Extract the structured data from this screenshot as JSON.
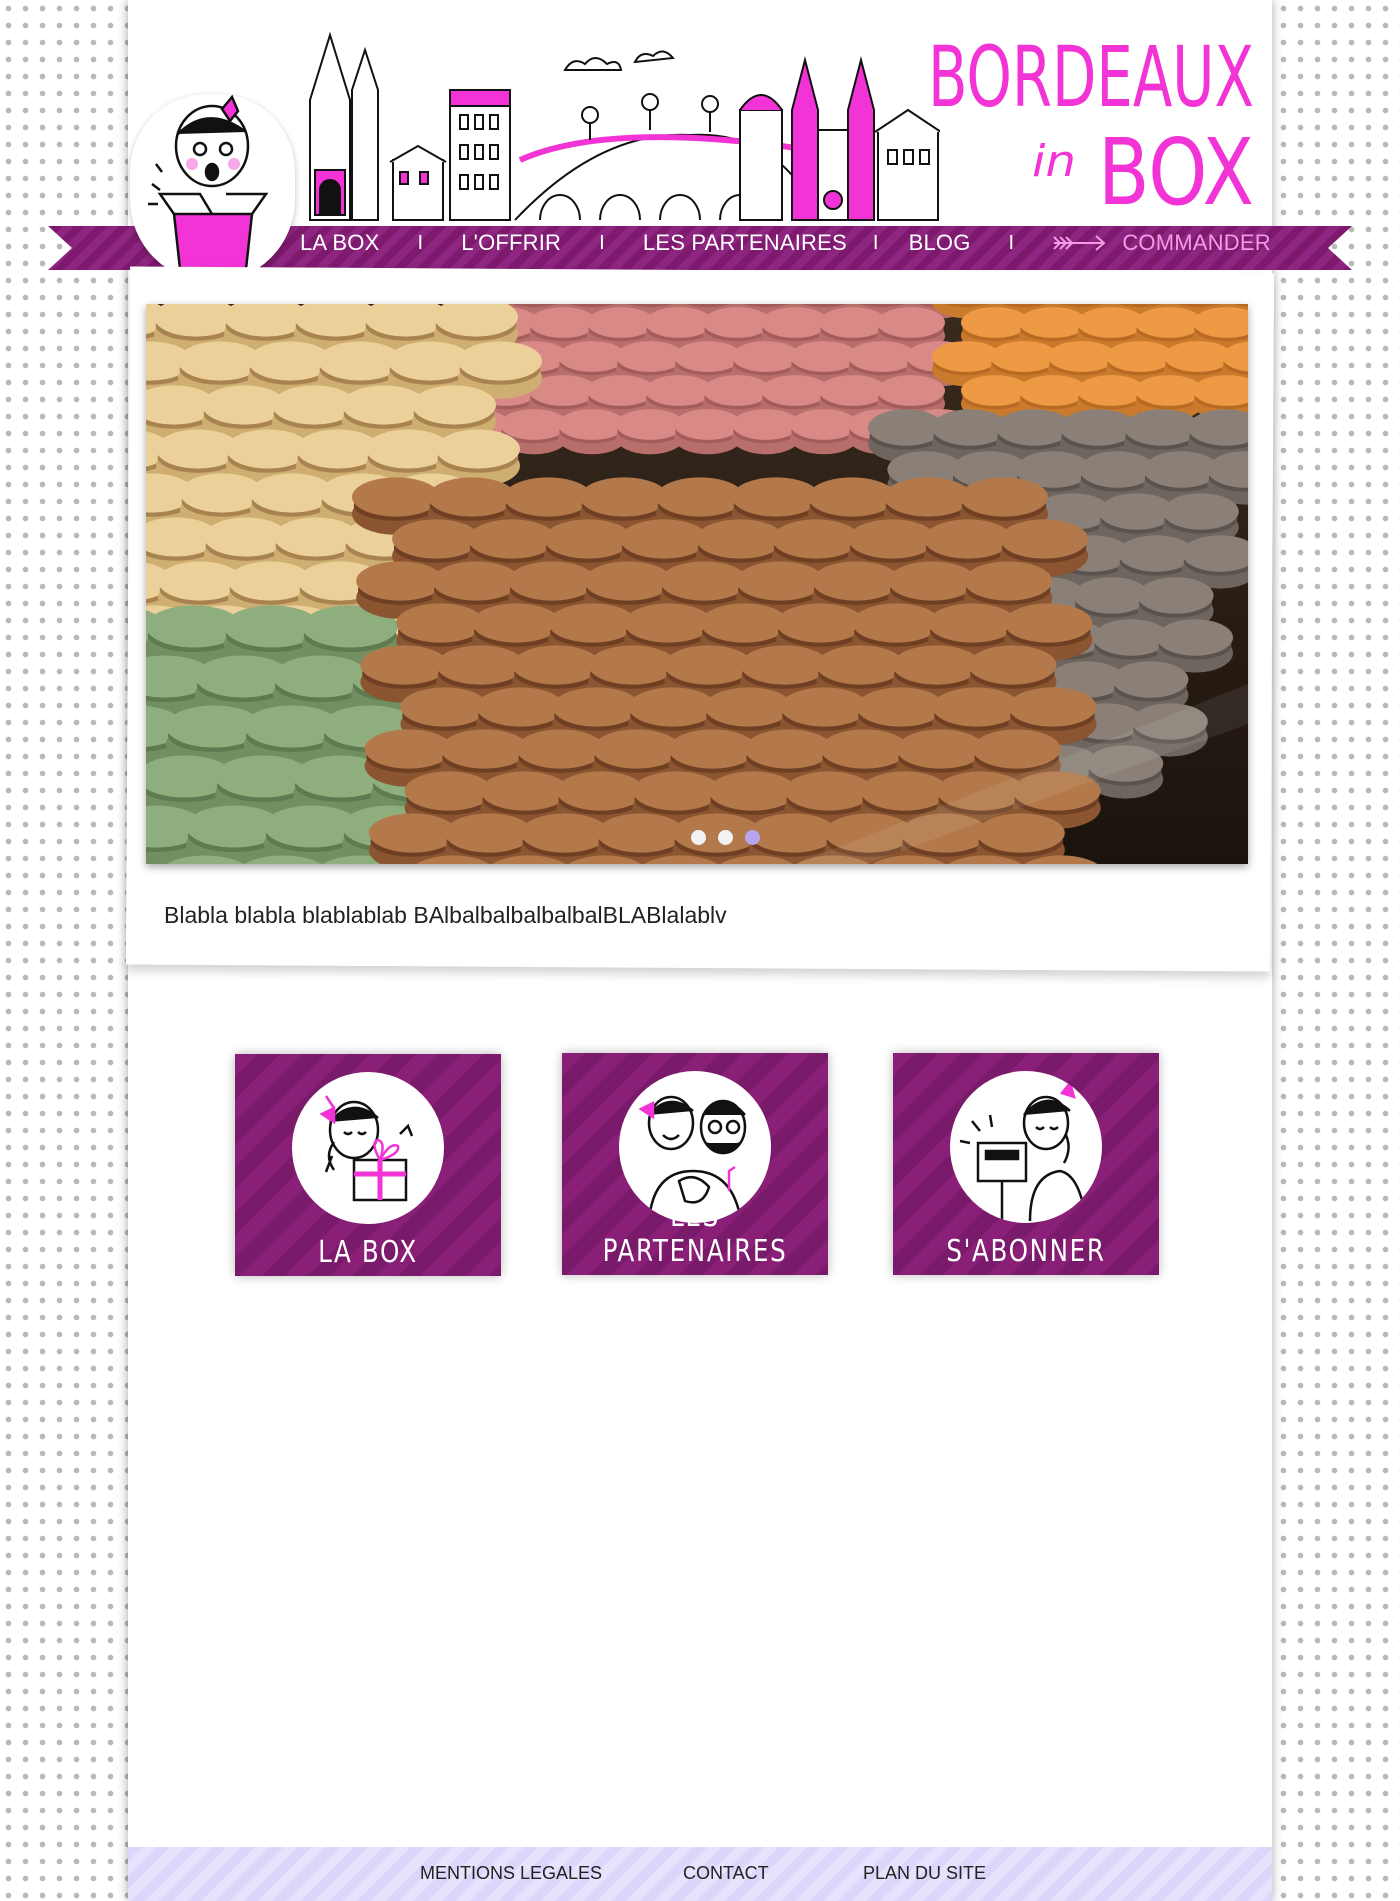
{
  "brand": {
    "logo_line1": "BORDEAUX",
    "logo_in": "in",
    "logo_line2": "BOX",
    "accent": "#f233d6",
    "ribbon_color": "#7d1a6e"
  },
  "nav": {
    "items": [
      {
        "label": "LA BOX"
      },
      {
        "label": "L'OFFRIR"
      },
      {
        "label": "LES PARTENAIRES"
      },
      {
        "label": "BLOG"
      }
    ],
    "separator": "I",
    "cta_label": "COMMANDER",
    "cta_icon": "arrow-right-icon"
  },
  "slider": {
    "image": "macarons-photo",
    "slide_count": 3,
    "active_slide": 3
  },
  "caption": "Blabla blabla blablablab BAlbalbalbalbalbalBLABlalablv",
  "tiles": [
    {
      "label": "LA BOX",
      "icon": "girl-with-gift-icon"
    },
    {
      "label": "LES PARTENAIRES",
      "icon": "partners-icon"
    },
    {
      "label": "S'ABONNER",
      "icon": "girl-with-mailbox-icon"
    }
  ],
  "footer": {
    "links": [
      {
        "label": "MENTIONS LEGALES"
      },
      {
        "label": "CONTACT"
      },
      {
        "label": "PLAN DU SITE"
      }
    ]
  }
}
